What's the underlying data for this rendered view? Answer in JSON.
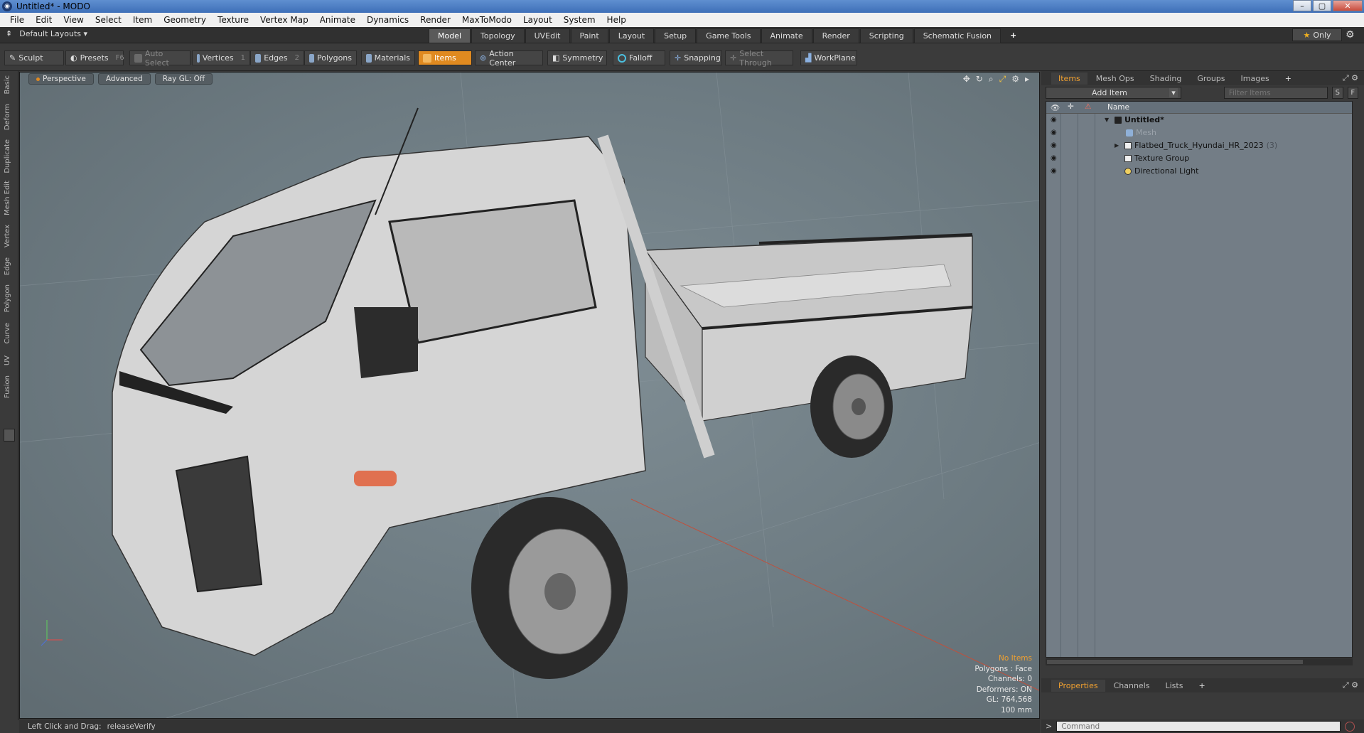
{
  "window": {
    "title": "Untitled* - MODO"
  },
  "menu": [
    "File",
    "Edit",
    "View",
    "Select",
    "Item",
    "Geometry",
    "Texture",
    "Vertex Map",
    "Animate",
    "Dynamics",
    "Render",
    "MaxToModo",
    "Layout",
    "System",
    "Help"
  ],
  "layouts": {
    "default_layouts": "Default Layouts ▾",
    "tabs": [
      "Model",
      "Topology",
      "UVEdit",
      "Paint",
      "Layout",
      "Setup",
      "Game Tools",
      "Animate",
      "Render",
      "Scripting",
      "Schematic Fusion"
    ],
    "active_tab": "Model",
    "only_label": "Only"
  },
  "toolbar": {
    "sculpt": "Sculpt",
    "presets": "Presets",
    "presets_key": "F6",
    "auto_select": "Auto Select",
    "vertices": "Vertices",
    "vertices_key": "1",
    "edges": "Edges",
    "edges_key": "2",
    "polygons": "Polygons",
    "materials": "Materials",
    "items": "Items",
    "action_center": "Action Center",
    "symmetry": "Symmetry",
    "falloff": "Falloff",
    "snapping": "Snapping",
    "select_through": "Select Through",
    "workplane": "WorkPlane"
  },
  "left_tabs": [
    "Basic",
    "Deform",
    "Duplicate",
    "Mesh Edit",
    "Vertex",
    "Edge",
    "Polygon",
    "Curve",
    "UV",
    "Fusion"
  ],
  "viewport": {
    "view_mode": "Perspective",
    "shading": "Advanced",
    "raygl": "Ray GL: Off",
    "info": {
      "no_items": "No Items",
      "polygons": "Polygons : Face",
      "channels": "Channels: 0",
      "deformers": "Deformers: ON",
      "gl": "GL: 764,568",
      "scale": "100 mm"
    }
  },
  "status": {
    "hint": "Left Click and Drag:",
    "action": "releaseVerify"
  },
  "items_panel": {
    "tabs": [
      "Items",
      "Mesh Ops",
      "Shading",
      "Groups",
      "Images"
    ],
    "active_tab": "Items",
    "add_item": "Add Item",
    "filter_placeholder": "Filter Items",
    "s_btn": "S",
    "f_btn": "F",
    "name_header": "Name",
    "rows": [
      {
        "label": "Untitled*"
      },
      {
        "label": "Mesh"
      },
      {
        "label": "Flatbed_Truck_Hyundai_HR_2023",
        "count": "(3)"
      },
      {
        "label": "Texture Group"
      },
      {
        "label": "Directional Light"
      }
    ]
  },
  "properties_panel": {
    "tabs": [
      "Properties",
      "Channels",
      "Lists"
    ],
    "active_tab": "Properties"
  },
  "command": {
    "placeholder": "Command"
  },
  "colors": {
    "accent": "#e08a20",
    "viewport_bg": "#6d7b82",
    "tree_bg": "#737d86"
  }
}
